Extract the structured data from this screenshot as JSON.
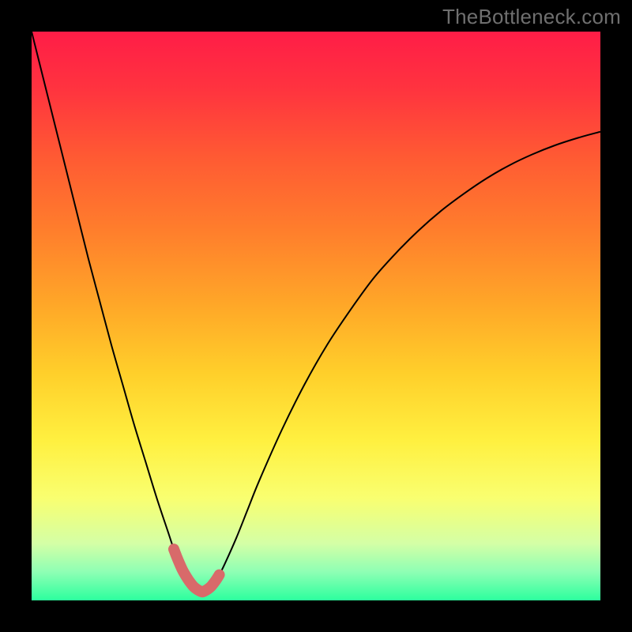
{
  "watermark": "TheBottleneck.com",
  "chart_data": {
    "type": "line",
    "title": "",
    "xlabel": "",
    "ylabel": "",
    "xlim": [
      0,
      100
    ],
    "ylim": [
      0,
      100
    ],
    "grid": false,
    "legend": false,
    "series": [
      {
        "name": "bottleneck-curve",
        "color": "#000000",
        "x": [
          0,
          2,
          4,
          6,
          8,
          10,
          12,
          14,
          16,
          18,
          20,
          22,
          24,
          25,
          26,
          27,
          28,
          29,
          30,
          31,
          32,
          33,
          34,
          36,
          38,
          40,
          44,
          48,
          52,
          56,
          60,
          64,
          68,
          72,
          76,
          80,
          84,
          88,
          92,
          96,
          100
        ],
        "y": [
          100,
          92,
          84,
          76,
          68,
          60,
          52.5,
          45,
          38,
          31,
          24.5,
          18,
          12,
          9,
          6.5,
          4.5,
          3,
          2,
          1.5,
          2,
          3,
          4.5,
          6.5,
          11,
          16,
          21,
          30,
          38,
          45,
          51,
          56.5,
          61,
          65,
          68.5,
          71.5,
          74.2,
          76.5,
          78.4,
          80,
          81.3,
          82.4
        ]
      },
      {
        "name": "trough-highlight",
        "color": "#d86a6a",
        "x": [
          25,
          25.5,
          26,
          26.5,
          27,
          27.5,
          28,
          28.5,
          29,
          29.5,
          30,
          30.5,
          31,
          31.5,
          32,
          32.5,
          33
        ],
        "y": [
          9,
          7.7,
          6.5,
          5.4,
          4.5,
          3.7,
          3,
          2.4,
          2,
          1.7,
          1.5,
          1.7,
          2,
          2.4,
          3,
          3.7,
          4.5
        ]
      }
    ],
    "background_gradient": {
      "stops": [
        {
          "offset": 0.0,
          "color": "#ff1d47"
        },
        {
          "offset": 0.1,
          "color": "#ff333f"
        },
        {
          "offset": 0.22,
          "color": "#ff5a33"
        },
        {
          "offset": 0.35,
          "color": "#ff7e2c"
        },
        {
          "offset": 0.48,
          "color": "#ffa728"
        },
        {
          "offset": 0.6,
          "color": "#ffcf2a"
        },
        {
          "offset": 0.72,
          "color": "#fff040"
        },
        {
          "offset": 0.82,
          "color": "#f9ff70"
        },
        {
          "offset": 0.9,
          "color": "#d4ffa6"
        },
        {
          "offset": 0.95,
          "color": "#8effb4"
        },
        {
          "offset": 1.0,
          "color": "#2cff9e"
        }
      ]
    }
  }
}
